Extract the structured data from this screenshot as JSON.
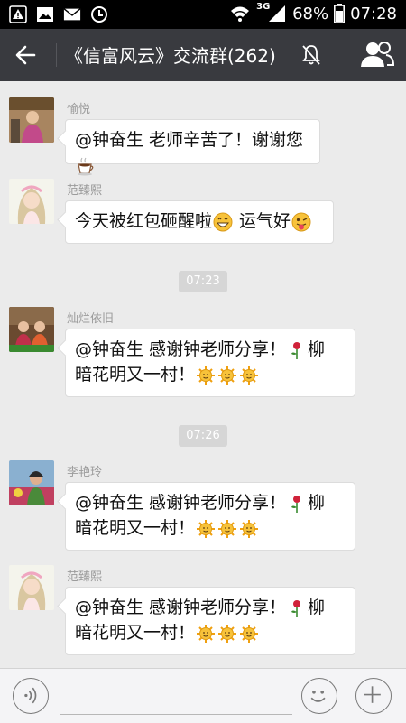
{
  "status_bar": {
    "network_label": "3G",
    "battery_percent": "68%",
    "time": "07:28"
  },
  "header": {
    "title": "《信富风云》交流群(262)"
  },
  "messages": [
    {
      "sender": "愉悦",
      "lines": [
        "@钟奋生 老师辛苦了！谢谢您"
      ],
      "trailing_emoji": "coffee-icon"
    },
    {
      "sender": "范臻熙",
      "lines": [
        "今天被红包砸醒啦",
        " 运气好"
      ],
      "emoji": [
        "grin-icon",
        "tongue-wink-icon"
      ]
    },
    {
      "time_separator": "07:23"
    },
    {
      "sender": "灿烂依旧",
      "line1": "@钟奋生 感谢钟老师分享！",
      "line1_end": "柳",
      "line2": "暗花明又一村！",
      "emoji": [
        "rose-icon",
        "sun-icon",
        "sun-icon",
        "sun-icon"
      ]
    },
    {
      "time_separator": "07:26"
    },
    {
      "sender": "李艳玲",
      "line1": "@钟奋生 感谢钟老师分享！",
      "line1_end": "柳",
      "line2": "暗花明又一村！"
    },
    {
      "sender": "范臻熙",
      "line1": "@钟奋生 感谢钟老师分享！",
      "line1_end": "柳",
      "line2": "暗花明又一村！"
    }
  ],
  "colors": {
    "title_bar": "#393a3f",
    "chat_bg": "#ebebeb",
    "bubble": "#ffffff",
    "sender_text": "#9b9b9b"
  }
}
